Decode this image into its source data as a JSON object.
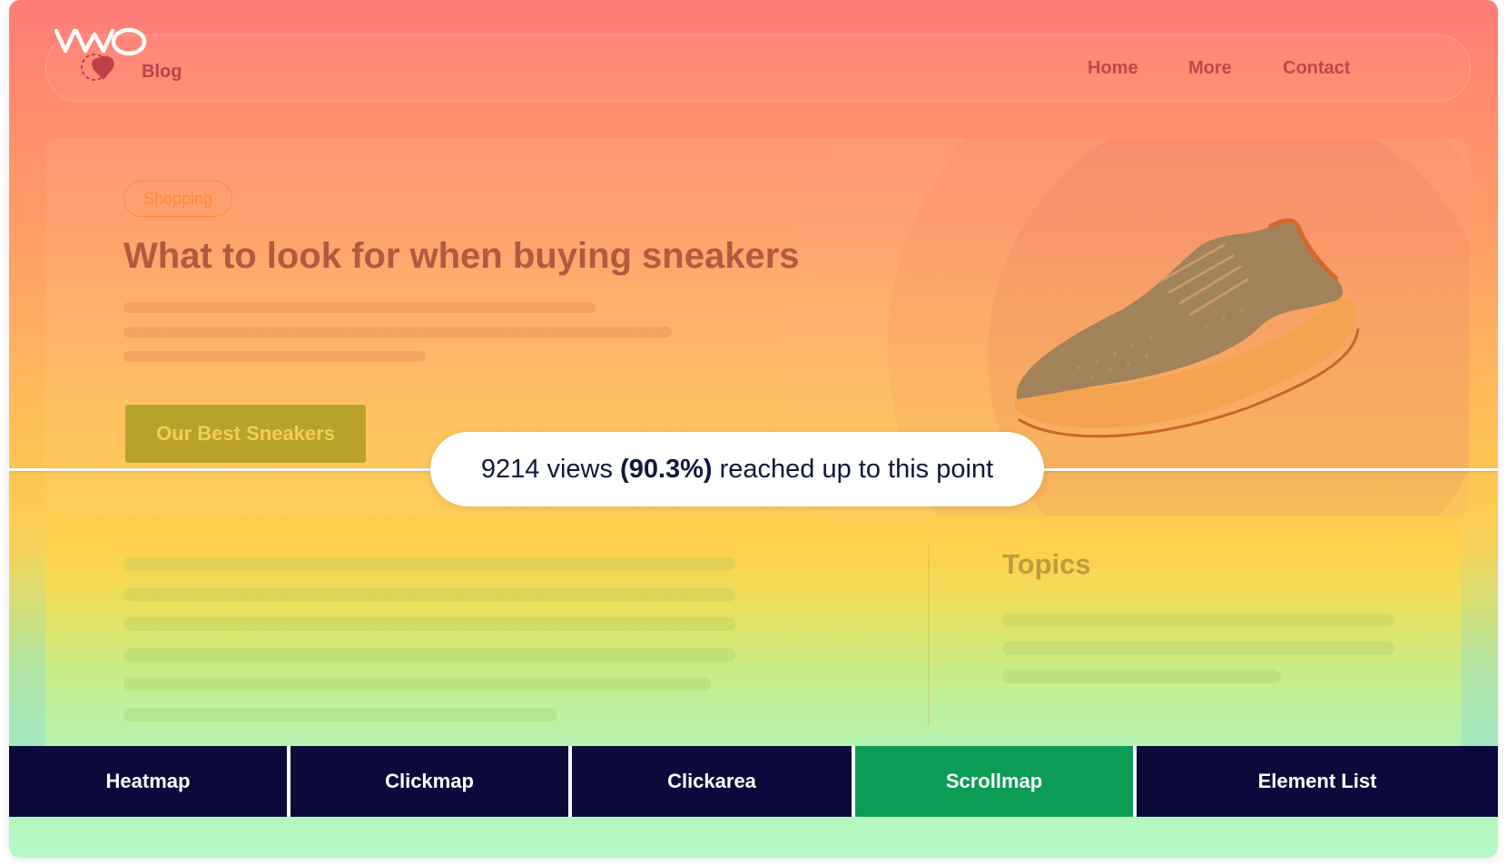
{
  "nav": {
    "logo_text": "VWO",
    "blog_label": "Blog",
    "links": [
      "Home",
      "More",
      "Contact"
    ]
  },
  "hero": {
    "tag": "Shopping",
    "title": "What to look for when buying sneakers",
    "cta": "Our Best Sneakers",
    "image": "sneaker-image"
  },
  "scroll_marker": {
    "views": "9214 views",
    "percent": "(90.3%)",
    "suffix": "reached up to this point"
  },
  "sidebar": {
    "title": "Topics"
  },
  "tabs": [
    {
      "label": "Heatmap",
      "active": false
    },
    {
      "label": "Clickmap",
      "active": false
    },
    {
      "label": "Clickarea",
      "active": false
    },
    {
      "label": "Scrollmap",
      "active": true
    },
    {
      "label": "Element List",
      "active": false
    }
  ],
  "colors": {
    "active_tab": "#0b9c56",
    "tab_bar": "#0b0a3a",
    "heat_top": "#ff7b7b",
    "heat_mid": "#ffc653",
    "heat_bottom": "#b6f7c6"
  }
}
